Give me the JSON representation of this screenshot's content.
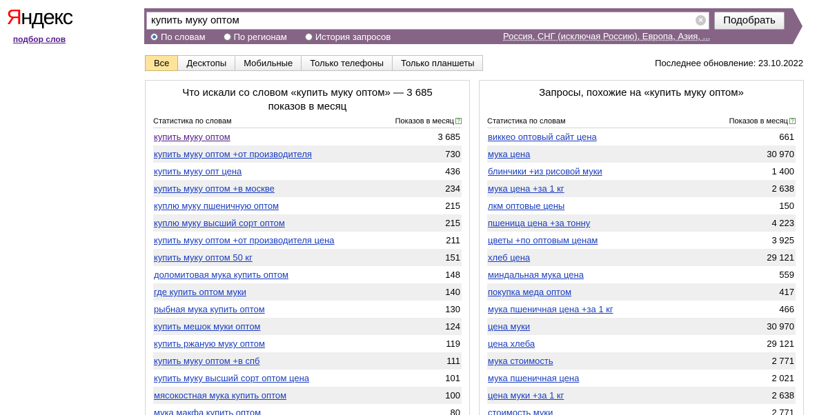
{
  "logo": {
    "text_first": "Я",
    "text_rest": "ндекс",
    "subtitle": "подбор слов"
  },
  "search": {
    "query": "купить муку оптом",
    "clear_icon": "×",
    "submit_label": "Подобрать",
    "modes": [
      {
        "label": "По словам",
        "selected": true
      },
      {
        "label": "По регионам",
        "selected": false
      },
      {
        "label": "История запросов",
        "selected": false
      }
    ],
    "region_text": "Россия, СНГ (исключая Россию), Европа, Азия, ..."
  },
  "tabs": [
    {
      "label": "Все",
      "active": true
    },
    {
      "label": "Десктопы",
      "active": false
    },
    {
      "label": "Мобильные",
      "active": false
    },
    {
      "label": "Только телефоны",
      "active": false
    },
    {
      "label": "Только планшеты",
      "active": false
    }
  ],
  "last_updated": "Последнее обновление: 23.10.2022",
  "left_panel": {
    "title": "Что искали со словом «купить муку оптом» — 3 685 показов в месяц",
    "col_phrase": "Статистика по словам",
    "col_count": "Показов в месяц",
    "help_icon": "?",
    "rows": [
      {
        "phrase": "купить муку оптом",
        "count": "3 685",
        "visited": true
      },
      {
        "phrase": "купить муку оптом +от производителя",
        "count": "730"
      },
      {
        "phrase": "купить муку опт цена",
        "count": "436"
      },
      {
        "phrase": "купить муку оптом +в москве",
        "count": "234"
      },
      {
        "phrase": "куплю муку пшеничную оптом",
        "count": "215"
      },
      {
        "phrase": "куплю муку высший сорт оптом",
        "count": "215"
      },
      {
        "phrase": "купить муку оптом +от производителя цена",
        "count": "211"
      },
      {
        "phrase": "купить муку оптом 50 кг",
        "count": "151"
      },
      {
        "phrase": "доломитовая мука купить оптом",
        "count": "148"
      },
      {
        "phrase": "где купить оптом муки",
        "count": "140"
      },
      {
        "phrase": "рыбная мука купить оптом",
        "count": "130"
      },
      {
        "phrase": "купить мешок муки оптом",
        "count": "124"
      },
      {
        "phrase": "купить ржаную муку оптом",
        "count": "119"
      },
      {
        "phrase": "купить муку оптом +в спб",
        "count": "111"
      },
      {
        "phrase": "купить муку высший сорт оптом цена",
        "count": "101"
      },
      {
        "phrase": "мясокостная мука купить оптом",
        "count": "100"
      },
      {
        "phrase": "мука макфа купить оптом",
        "count": "80"
      }
    ]
  },
  "right_panel": {
    "title": "Запросы, похожие на «купить муку оптом»",
    "col_phrase": "Статистика по словам",
    "col_count": "Показов в месяц",
    "help_icon": "?",
    "rows": [
      {
        "phrase": "виккео оптовый сайт цена",
        "count": "661"
      },
      {
        "phrase": "мука цена",
        "count": "30 970"
      },
      {
        "phrase": "блинчики +из рисовой муки",
        "count": "1 400"
      },
      {
        "phrase": "мука цена +за 1 кг",
        "count": "2 638"
      },
      {
        "phrase": "лкм оптовые цены",
        "count": "150"
      },
      {
        "phrase": "пшеница цена +за тонну",
        "count": "4 223"
      },
      {
        "phrase": "цветы +по оптовым ценам",
        "count": "3 925"
      },
      {
        "phrase": "хлеб цена",
        "count": "29 121"
      },
      {
        "phrase": "миндальная мука цена",
        "count": "559"
      },
      {
        "phrase": "покупка меда оптом",
        "count": "417"
      },
      {
        "phrase": "мука пшеничная цена +за 1 кг",
        "count": "466"
      },
      {
        "phrase": "цена муки",
        "count": "30 970"
      },
      {
        "phrase": "цена хлеба",
        "count": "29 121"
      },
      {
        "phrase": "мука стоимость",
        "count": "2 771"
      },
      {
        "phrase": "мука пшеничная цена",
        "count": "2 021"
      },
      {
        "phrase": "цена муки +за 1 кг",
        "count": "2 638"
      },
      {
        "phrase": "стоимость муки",
        "count": "2 771"
      }
    ]
  }
}
